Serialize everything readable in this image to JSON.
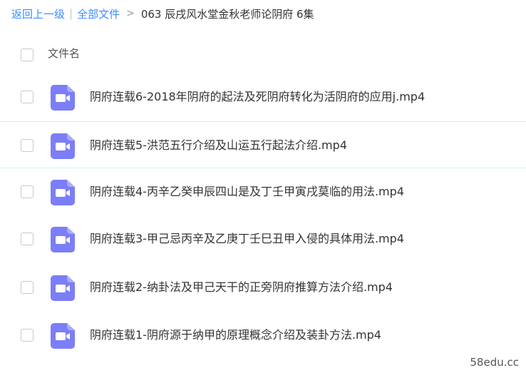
{
  "breadcrumb": {
    "back_label": "返回上一级",
    "separator": "|",
    "all_files_label": "全部文件",
    "arrow": ">",
    "current_folder": "063 辰戌风水堂金秋老师论阴府 6集"
  },
  "list_header": {
    "column_label": "文件名"
  },
  "files": [
    {
      "name": "阴府连载6-2018年阴府的起法及死阴府转化为活阴府的应用j.mp4",
      "icon": "video-file-icon"
    },
    {
      "name": "阴府连载5-洪范五行介绍及山运五行起法介绍.mp4",
      "icon": "video-file-icon"
    },
    {
      "name": "阴府连载4-丙辛乙癸申辰四山是及丁壬甲寅戌莫临的用法.mp4",
      "icon": "video-file-icon"
    },
    {
      "name": "阴府连载3-甲己忌丙辛及乙庚丁壬巳丑甲入侵的具体用法.mp4",
      "icon": "video-file-icon"
    },
    {
      "name": "阴府连载2-纳卦法及甲己天干的正旁阴府推算方法介绍.mp4",
      "icon": "video-file-icon"
    },
    {
      "name": "阴府连载1-阴府源于纳甲的原理概念介绍及装卦方法.mp4",
      "icon": "video-file-icon"
    }
  ],
  "watermark": "58edu.cc",
  "colors": {
    "link": "#3b8cff",
    "icon_bg": "#7b7ef7",
    "row_divider": "#d6eef4"
  }
}
